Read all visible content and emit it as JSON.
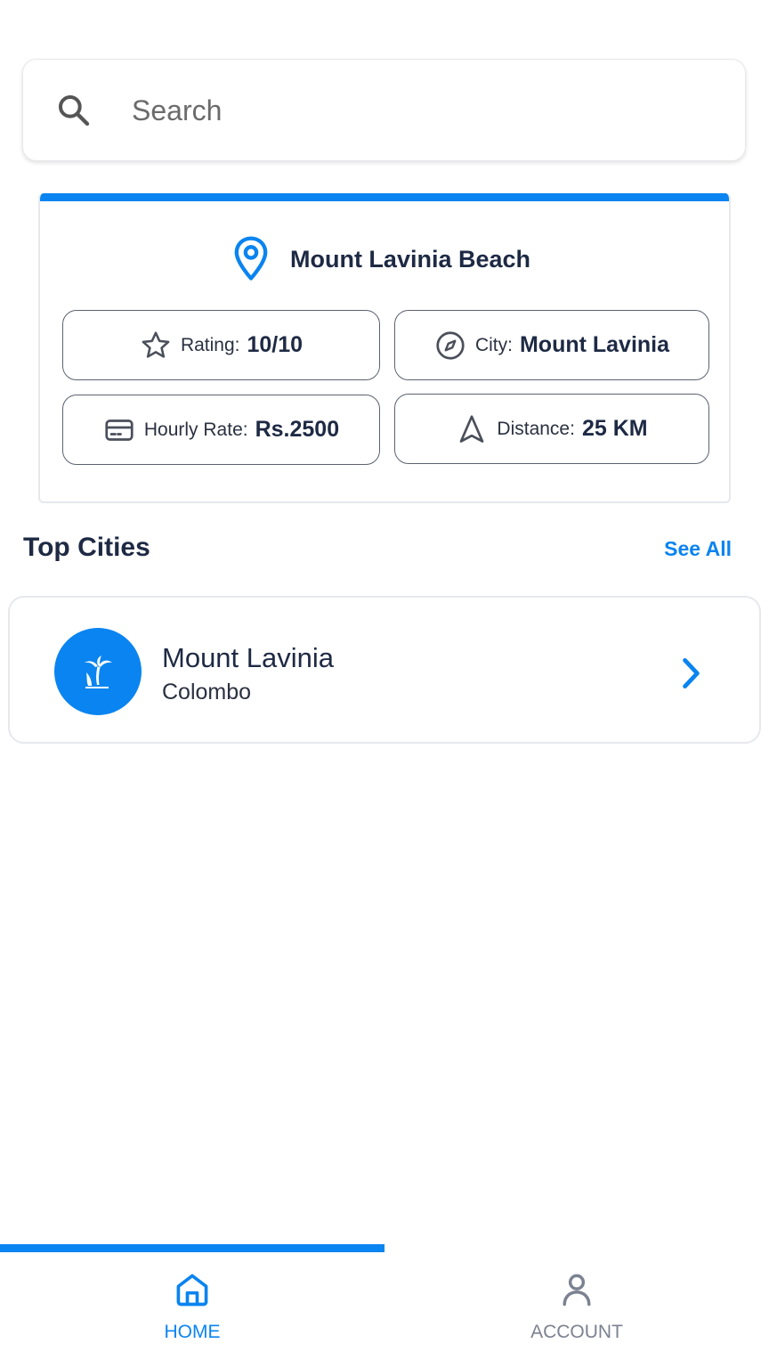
{
  "search": {
    "placeholder": "Search"
  },
  "featured": {
    "title": "Mount Lavinia Beach",
    "rating_label": "Rating:",
    "rating_value": "10/10",
    "city_label": "City:",
    "city_value": "Mount Lavinia",
    "rate_label": "Hourly Rate:",
    "rate_value": "Rs.2500",
    "distance_label": "Distance:",
    "distance_value": "25 KM"
  },
  "top_cities": {
    "title": "Top Cities",
    "see_all": "See All",
    "items": [
      {
        "name": "Mount Lavinia",
        "subtitle": "Colombo",
        "icon": "palm-tree-icon"
      }
    ]
  },
  "bottom_nav": {
    "items": [
      {
        "label": "HOME",
        "icon": "home-icon",
        "active": true
      },
      {
        "label": "ACCOUNT",
        "icon": "person-icon",
        "active": false
      }
    ]
  },
  "colors": {
    "accent": "#0a84f0",
    "text": "#1e2a44",
    "inactive": "#7b8291"
  }
}
